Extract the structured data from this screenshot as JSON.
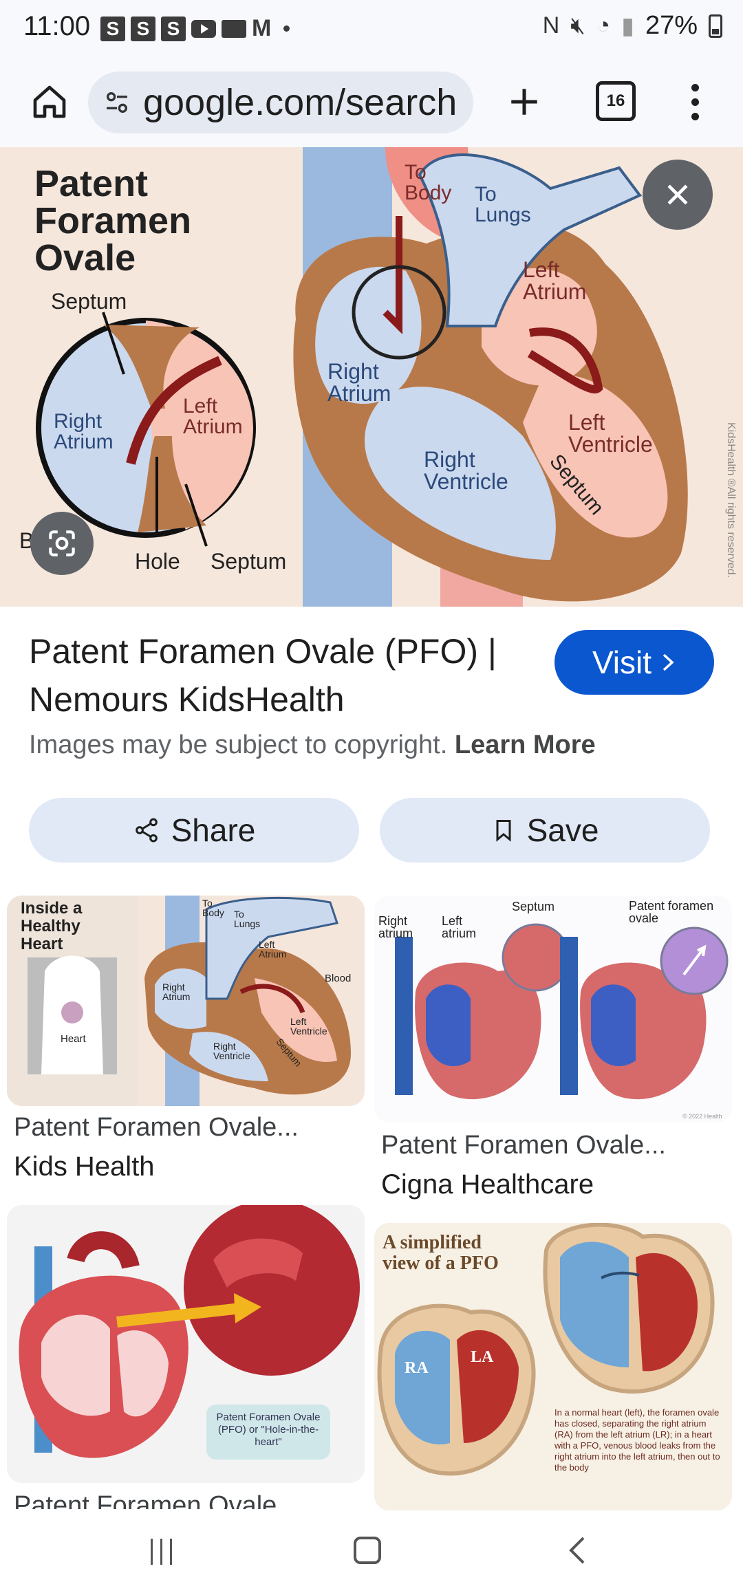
{
  "status_bar": {
    "time": "11:00",
    "notif_icons": [
      "S",
      "S",
      "S"
    ],
    "battery": "27%"
  },
  "browser": {
    "url": "google.com/search",
    "tab_count": "16"
  },
  "hero": {
    "labels": {
      "title_line1": "Patent",
      "title_line2": "Foramen",
      "title_line3": "Ovale",
      "septum_top": "Septum",
      "right_atrium_inset": "Right Atrium",
      "left_atrium_inset": "Left Atrium",
      "blood": "Blood",
      "hole": "Hole",
      "septum_bottom": "Septum",
      "to_body": "To Body",
      "to_lungs": "To Lungs",
      "left_atrium": "Left Atrium",
      "right_atrium": "Right Atrium",
      "left_ventricle": "Left Ventricle",
      "right_ventricle": "Right Ventricle",
      "septum_heart": "Septum",
      "credit": "KidsHealth ®All rights reserved."
    }
  },
  "result": {
    "title": "Patent Foramen Ovale (PFO) | Nemours KidsHealth",
    "visit_label": "Visit",
    "copyright_text": "Images may be subject to copyright.",
    "learn_more": "Learn More",
    "share_label": "Share",
    "save_label": "Save"
  },
  "related": [
    {
      "title": "Patent Foramen Ovale...",
      "source": "Kids Health",
      "labels": [
        "Inside a Healthy Heart",
        "Heart",
        "To Body",
        "To Lungs",
        "Left Atrium",
        "Right Atrium",
        "Blood",
        "Left Ventricle",
        "Right Ventricle",
        "Septum"
      ]
    },
    {
      "title": "Patent Foramen Ovale...",
      "source": "Cigna Healthcare",
      "labels": [
        "Right atrium",
        "Left atrium",
        "Septum",
        "Patent foramen ovale",
        "© 2022 Health"
      ]
    },
    {
      "title": "Patent Foramen Ovale",
      "source": "",
      "labels": [
        "Patent Foramen Ovale (PFO) or \"Hole-in-the-heart\""
      ]
    },
    {
      "title": "",
      "source": "",
      "labels": [
        "A simplified view of a PFO",
        "RA",
        "LA",
        "In a normal heart (left), the foramen ovale has closed, separating the right atrium (RA) from the left atrium (LR); in a heart with a PFO, venous blood leaks from the right atrium into the left atrium, then out to the body"
      ]
    }
  ],
  "colors": {
    "accent": "#0b57d0",
    "chip": "#e1e9f7",
    "url_pill": "#e5eaf2"
  }
}
